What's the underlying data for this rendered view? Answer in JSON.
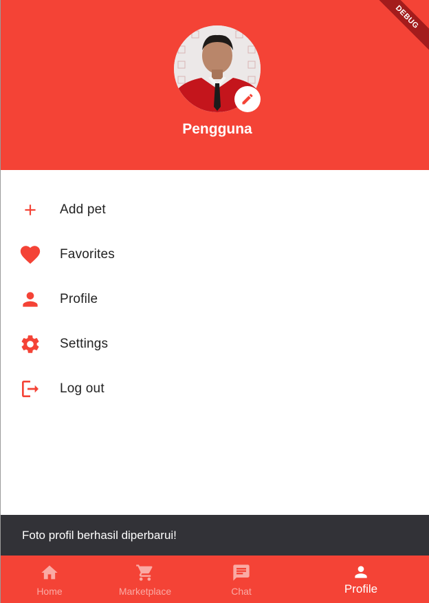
{
  "colors": {
    "primary": "#F44336",
    "snackbar": "#323237",
    "nav_inactive": "rgba(255,255,255,0.55)",
    "nav_active": "#FFFFFF"
  },
  "debug_banner": {
    "label": "DEBUG"
  },
  "header": {
    "username": "Pengguna",
    "avatar_icon": "profile-photo",
    "edit_icon": "pencil-icon"
  },
  "menu": {
    "items": [
      {
        "label": "Add pet",
        "icon": "plus-icon"
      },
      {
        "label": "Favorites",
        "icon": "heart-icon"
      },
      {
        "label": "Profile",
        "icon": "person-icon"
      },
      {
        "label": "Settings",
        "icon": "gear-icon"
      },
      {
        "label": "Log out",
        "icon": "logout-icon"
      }
    ]
  },
  "snackbar": {
    "message": "Foto profil berhasil diperbarui!"
  },
  "bottom_nav": {
    "items": [
      {
        "label": "Home",
        "icon": "home-icon",
        "active": false
      },
      {
        "label": "Marketplace",
        "icon": "cart-icon",
        "active": false
      },
      {
        "label": "Chat",
        "icon": "chat-icon",
        "active": false
      },
      {
        "label": "Profile",
        "icon": "person-icon",
        "active": true
      }
    ]
  }
}
